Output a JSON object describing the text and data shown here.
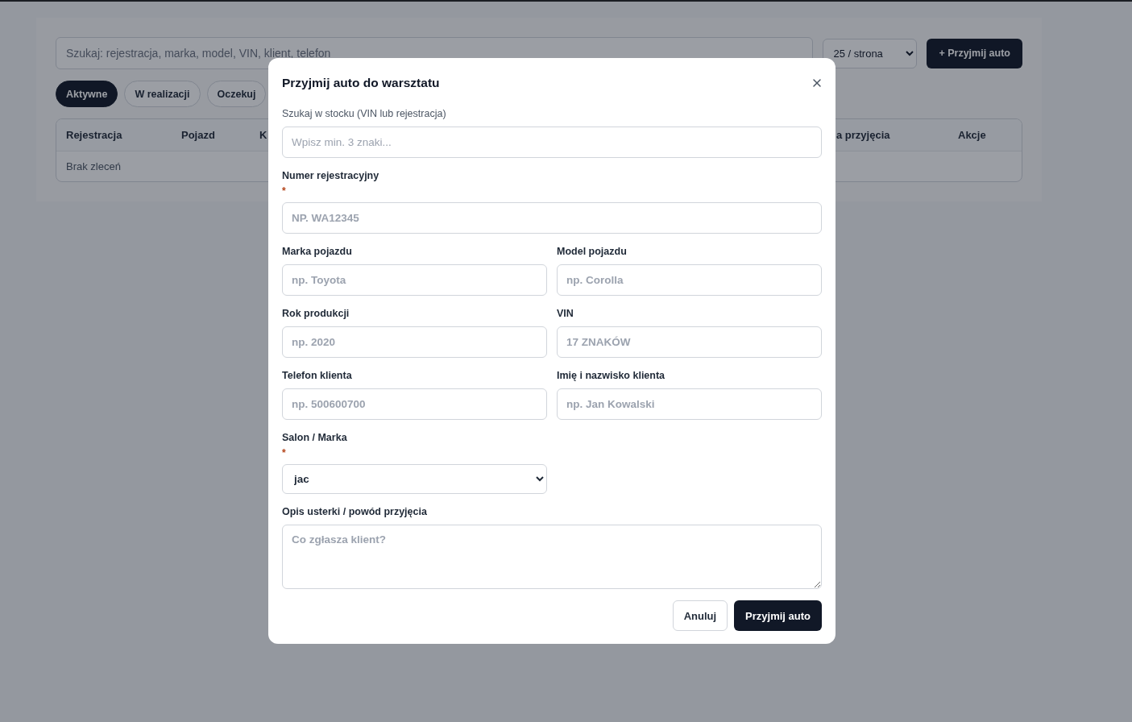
{
  "page": {
    "search": {
      "placeholder": "Szukaj: rejestracja, marka, model, VIN, klient, telefon"
    },
    "per_page": {
      "value": "25 / strona"
    },
    "add_button": "+ Przyjmij auto",
    "filters": [
      {
        "label": "Aktywne",
        "selected": true
      },
      {
        "label": "W realizacji",
        "selected": false
      },
      {
        "label": "Oczekuj",
        "selected": false
      }
    ],
    "table": {
      "columns": [
        "Rejestracja",
        "Pojazd",
        "K",
        "a przyjęcia",
        "Akcje"
      ],
      "empty": "Brak zleceń"
    }
  },
  "modal": {
    "title": "Przyjmij auto do warsztatu",
    "rows": [
      [
        {
          "kind": "search",
          "label": "Szukaj w stocku (VIN lub rejestracja)",
          "placeholder": "Wpisz min. 3 znaki...",
          "required": false
        }
      ],
      [
        {
          "kind": "text",
          "label": "Numer rejestracyjny",
          "placeholder": "NP. WA12345",
          "required": true
        }
      ],
      [
        {
          "kind": "text",
          "label": "Marka pojazdu",
          "placeholder": "np. Toyota",
          "required": false
        },
        {
          "kind": "text",
          "label": "Model pojazdu",
          "placeholder": "np. Corolla",
          "required": false
        }
      ],
      [
        {
          "kind": "text",
          "label": "Rok produkcji",
          "placeholder": "np. 2020",
          "required": false
        },
        {
          "kind": "text",
          "label": "VIN",
          "placeholder": "17 ZNAKÓW",
          "required": false
        }
      ],
      [
        {
          "kind": "text",
          "label": "Telefon klienta",
          "placeholder": "np. 500600700",
          "required": false
        },
        {
          "kind": "text",
          "label": "Imię i nazwisko klienta",
          "placeholder": "np. Jan Kowalski",
          "required": false
        }
      ],
      [
        {
          "kind": "select",
          "label": "Salon / Marka",
          "value": "jac",
          "required": true
        },
        {
          "kind": "empty"
        }
      ],
      [
        {
          "kind": "textarea",
          "label": "Opis usterki / powód przyjęcia",
          "placeholder": "Co zgłasza klient?",
          "required": false
        }
      ]
    ],
    "required_mark": "*",
    "cancel": "Anuluj",
    "submit": "Przyjmij auto"
  }
}
